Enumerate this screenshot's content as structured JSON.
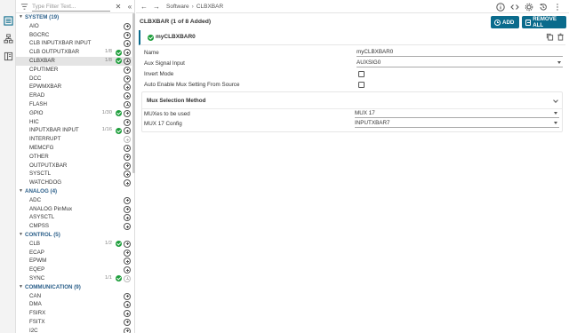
{
  "filter": {
    "placeholder": "Type Filter Text..."
  },
  "tree": [
    {
      "type": "cat",
      "label": "SYSTEM (19)"
    },
    {
      "type": "mod",
      "label": "AIO",
      "add": "enabled"
    },
    {
      "type": "mod",
      "label": "BGCRC",
      "add": "enabled"
    },
    {
      "type": "mod",
      "label": "CLB INPUTXBAR INPUT",
      "add": "enabled"
    },
    {
      "type": "mod",
      "label": "CLB OUTPUTXBAR",
      "count": "1/8",
      "checked": true,
      "add": "enabled"
    },
    {
      "type": "mod",
      "label": "CLBXBAR",
      "count": "1/8",
      "checked": true,
      "add": "enabled",
      "selected": true
    },
    {
      "type": "mod",
      "label": "CPUTIMER",
      "add": "enabled"
    },
    {
      "type": "mod",
      "label": "DCC",
      "add": "enabled"
    },
    {
      "type": "mod",
      "label": "EPWMXBAR",
      "add": "enabled"
    },
    {
      "type": "mod",
      "label": "ERAD",
      "add": "enabled"
    },
    {
      "type": "mod",
      "label": "FLASH",
      "add": "enabled"
    },
    {
      "type": "mod",
      "label": "GPIO",
      "count": "1/30",
      "checked": true,
      "add": "enabled"
    },
    {
      "type": "mod",
      "label": "HIC",
      "add": "enabled"
    },
    {
      "type": "mod",
      "label": "INPUTXBAR INPUT",
      "count": "1/16",
      "checked": true,
      "add": "enabled"
    },
    {
      "type": "mod",
      "label": "INTERRUPT",
      "add": "disabled"
    },
    {
      "type": "mod",
      "label": "MEMCFG",
      "add": "enabled"
    },
    {
      "type": "mod",
      "label": "OTHER",
      "add": "enabled"
    },
    {
      "type": "mod",
      "label": "OUTPUTXBAR",
      "add": "enabled"
    },
    {
      "type": "mod",
      "label": "SYSCTL",
      "add": "enabled"
    },
    {
      "type": "mod",
      "label": "WATCHDOG",
      "add": "enabled"
    },
    {
      "type": "cat",
      "label": "ANALOG (4)"
    },
    {
      "type": "mod",
      "label": "ADC",
      "add": "enabled"
    },
    {
      "type": "mod",
      "label": "ANALOG PinMux",
      "add": "enabled"
    },
    {
      "type": "mod",
      "label": "ASYSCTL",
      "add": "enabled"
    },
    {
      "type": "mod",
      "label": "CMPSS",
      "add": "enabled"
    },
    {
      "type": "cat",
      "label": "CONTROL (5)"
    },
    {
      "type": "mod",
      "label": "CLB",
      "count": "1/2",
      "checked": true,
      "add": "enabled"
    },
    {
      "type": "mod",
      "label": "ECAP",
      "add": "enabled"
    },
    {
      "type": "mod",
      "label": "EPWM",
      "add": "enabled"
    },
    {
      "type": "mod",
      "label": "EQEP",
      "add": "enabled"
    },
    {
      "type": "mod",
      "label": "SYNC",
      "count": "1/1",
      "checked": true,
      "add": "disabled"
    },
    {
      "type": "cat",
      "label": "COMMUNICATION (9)"
    },
    {
      "type": "mod",
      "label": "CAN",
      "add": "enabled"
    },
    {
      "type": "mod",
      "label": "DMA",
      "add": "enabled"
    },
    {
      "type": "mod",
      "label": "FSIRX",
      "add": "enabled"
    },
    {
      "type": "mod",
      "label": "FSITX",
      "add": "enabled"
    },
    {
      "type": "mod",
      "label": "I2C",
      "add": "enabled"
    }
  ],
  "breadcrumb": {
    "root": "Software",
    "separator": "›",
    "current": "CLBXBAR"
  },
  "module": {
    "title": "CLBXBAR (1 of 8 Added)",
    "add_label": "ADD",
    "remove_label": "REMOVE ALL",
    "instance_name": "myCLBXBAR0"
  },
  "fields": {
    "name_label": "Name",
    "name_value": "myCLBXBAR0",
    "aux_label": "Aux Signal Input",
    "aux_value": "AUXSIG0",
    "invert_label": "Invert Mode",
    "auto_label": "Auto Enable Mux Setting From Source"
  },
  "mux_group": {
    "title": "Mux Selection Method",
    "muxes_label": "MUXes to be used",
    "muxes_value": "MUX 17",
    "config_label": "MUX 17 Config",
    "config_value": "INPUTXBAR7"
  },
  "colors": {
    "accent": "#0a6b8c",
    "check": "#1e9e3c",
    "category": "#2b5f8a"
  }
}
